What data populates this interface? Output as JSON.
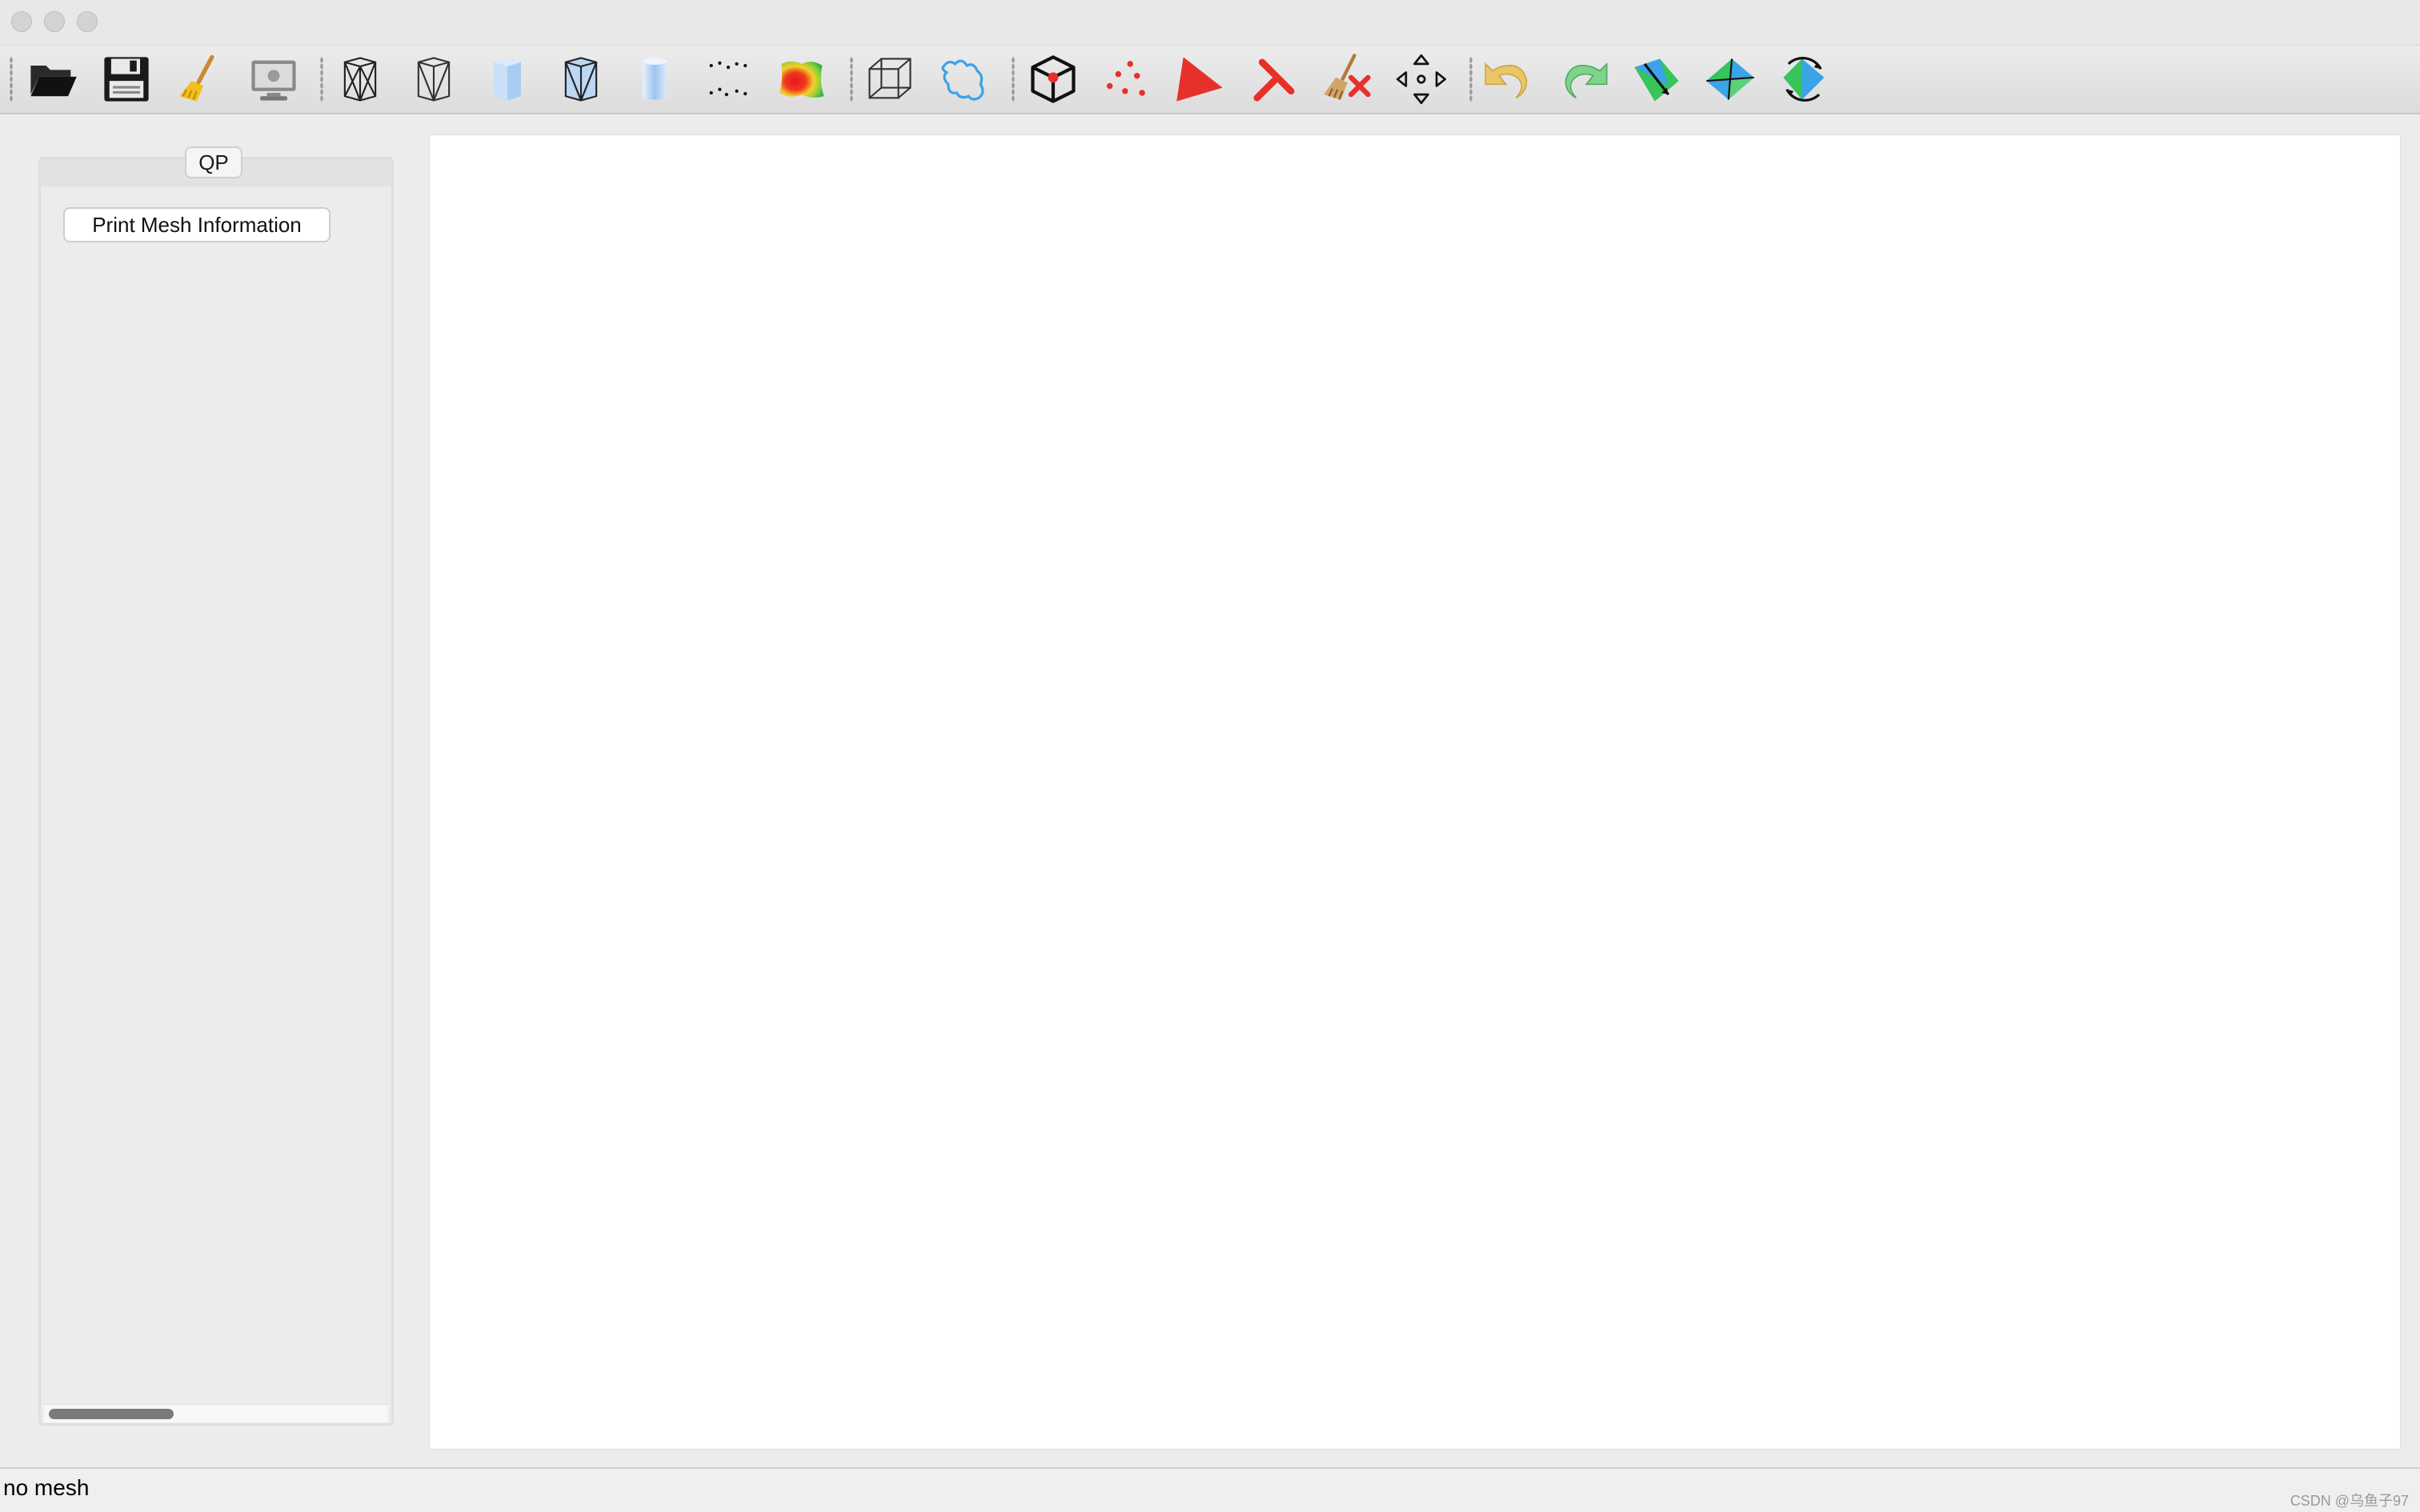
{
  "window": {
    "traffic_lights": [
      "close",
      "minimize",
      "zoom"
    ]
  },
  "toolbar": {
    "buttons": [
      {
        "id": "open",
        "icon": "folder-open-icon"
      },
      {
        "id": "save",
        "icon": "floppy-disk-icon"
      },
      {
        "id": "clear",
        "icon": "broom-icon"
      },
      {
        "id": "snapshot",
        "icon": "monitor-screenshot-icon"
      },
      {
        "id": "wireframe",
        "icon": "wireframe-icon"
      },
      {
        "id": "hidden-lines",
        "icon": "hidden-lines-icon"
      },
      {
        "id": "flat",
        "icon": "flat-shading-icon"
      },
      {
        "id": "flat-lines",
        "icon": "flat-lines-icon"
      },
      {
        "id": "smooth",
        "icon": "smooth-shading-icon"
      },
      {
        "id": "points",
        "icon": "point-cloud-icon"
      },
      {
        "id": "colormap",
        "icon": "color-map-icon"
      },
      {
        "id": "bbox",
        "icon": "bounding-box-icon"
      },
      {
        "id": "boundary",
        "icon": "boundary-curve-icon"
      },
      {
        "id": "select-vertex",
        "icon": "select-vertex-icon"
      },
      {
        "id": "select-points",
        "icon": "select-points-icon"
      },
      {
        "id": "select-face",
        "icon": "select-face-icon"
      },
      {
        "id": "select-edge",
        "icon": "select-edge-icon"
      },
      {
        "id": "clear-select",
        "icon": "clear-selection-icon"
      },
      {
        "id": "move",
        "icon": "move-arrows-icon"
      },
      {
        "id": "undo",
        "icon": "undo-icon"
      },
      {
        "id": "redo",
        "icon": "redo-icon"
      },
      {
        "id": "edge-split",
        "icon": "edge-split-icon"
      },
      {
        "id": "edge-collapse",
        "icon": "edge-collapse-icon"
      },
      {
        "id": "edge-flip",
        "icon": "edge-flip-icon"
      }
    ]
  },
  "dock": {
    "tab_label": "QP",
    "print_button_label": "Print Mesh Information"
  },
  "status": {
    "text": "no mesh"
  },
  "watermark": "CSDN @乌鱼子97",
  "colors": {
    "selection_red": "#e8302a",
    "accent_blue": "#3ba3e8",
    "accent_green": "#37c45a",
    "undo_yellow": "#e9c766"
  }
}
